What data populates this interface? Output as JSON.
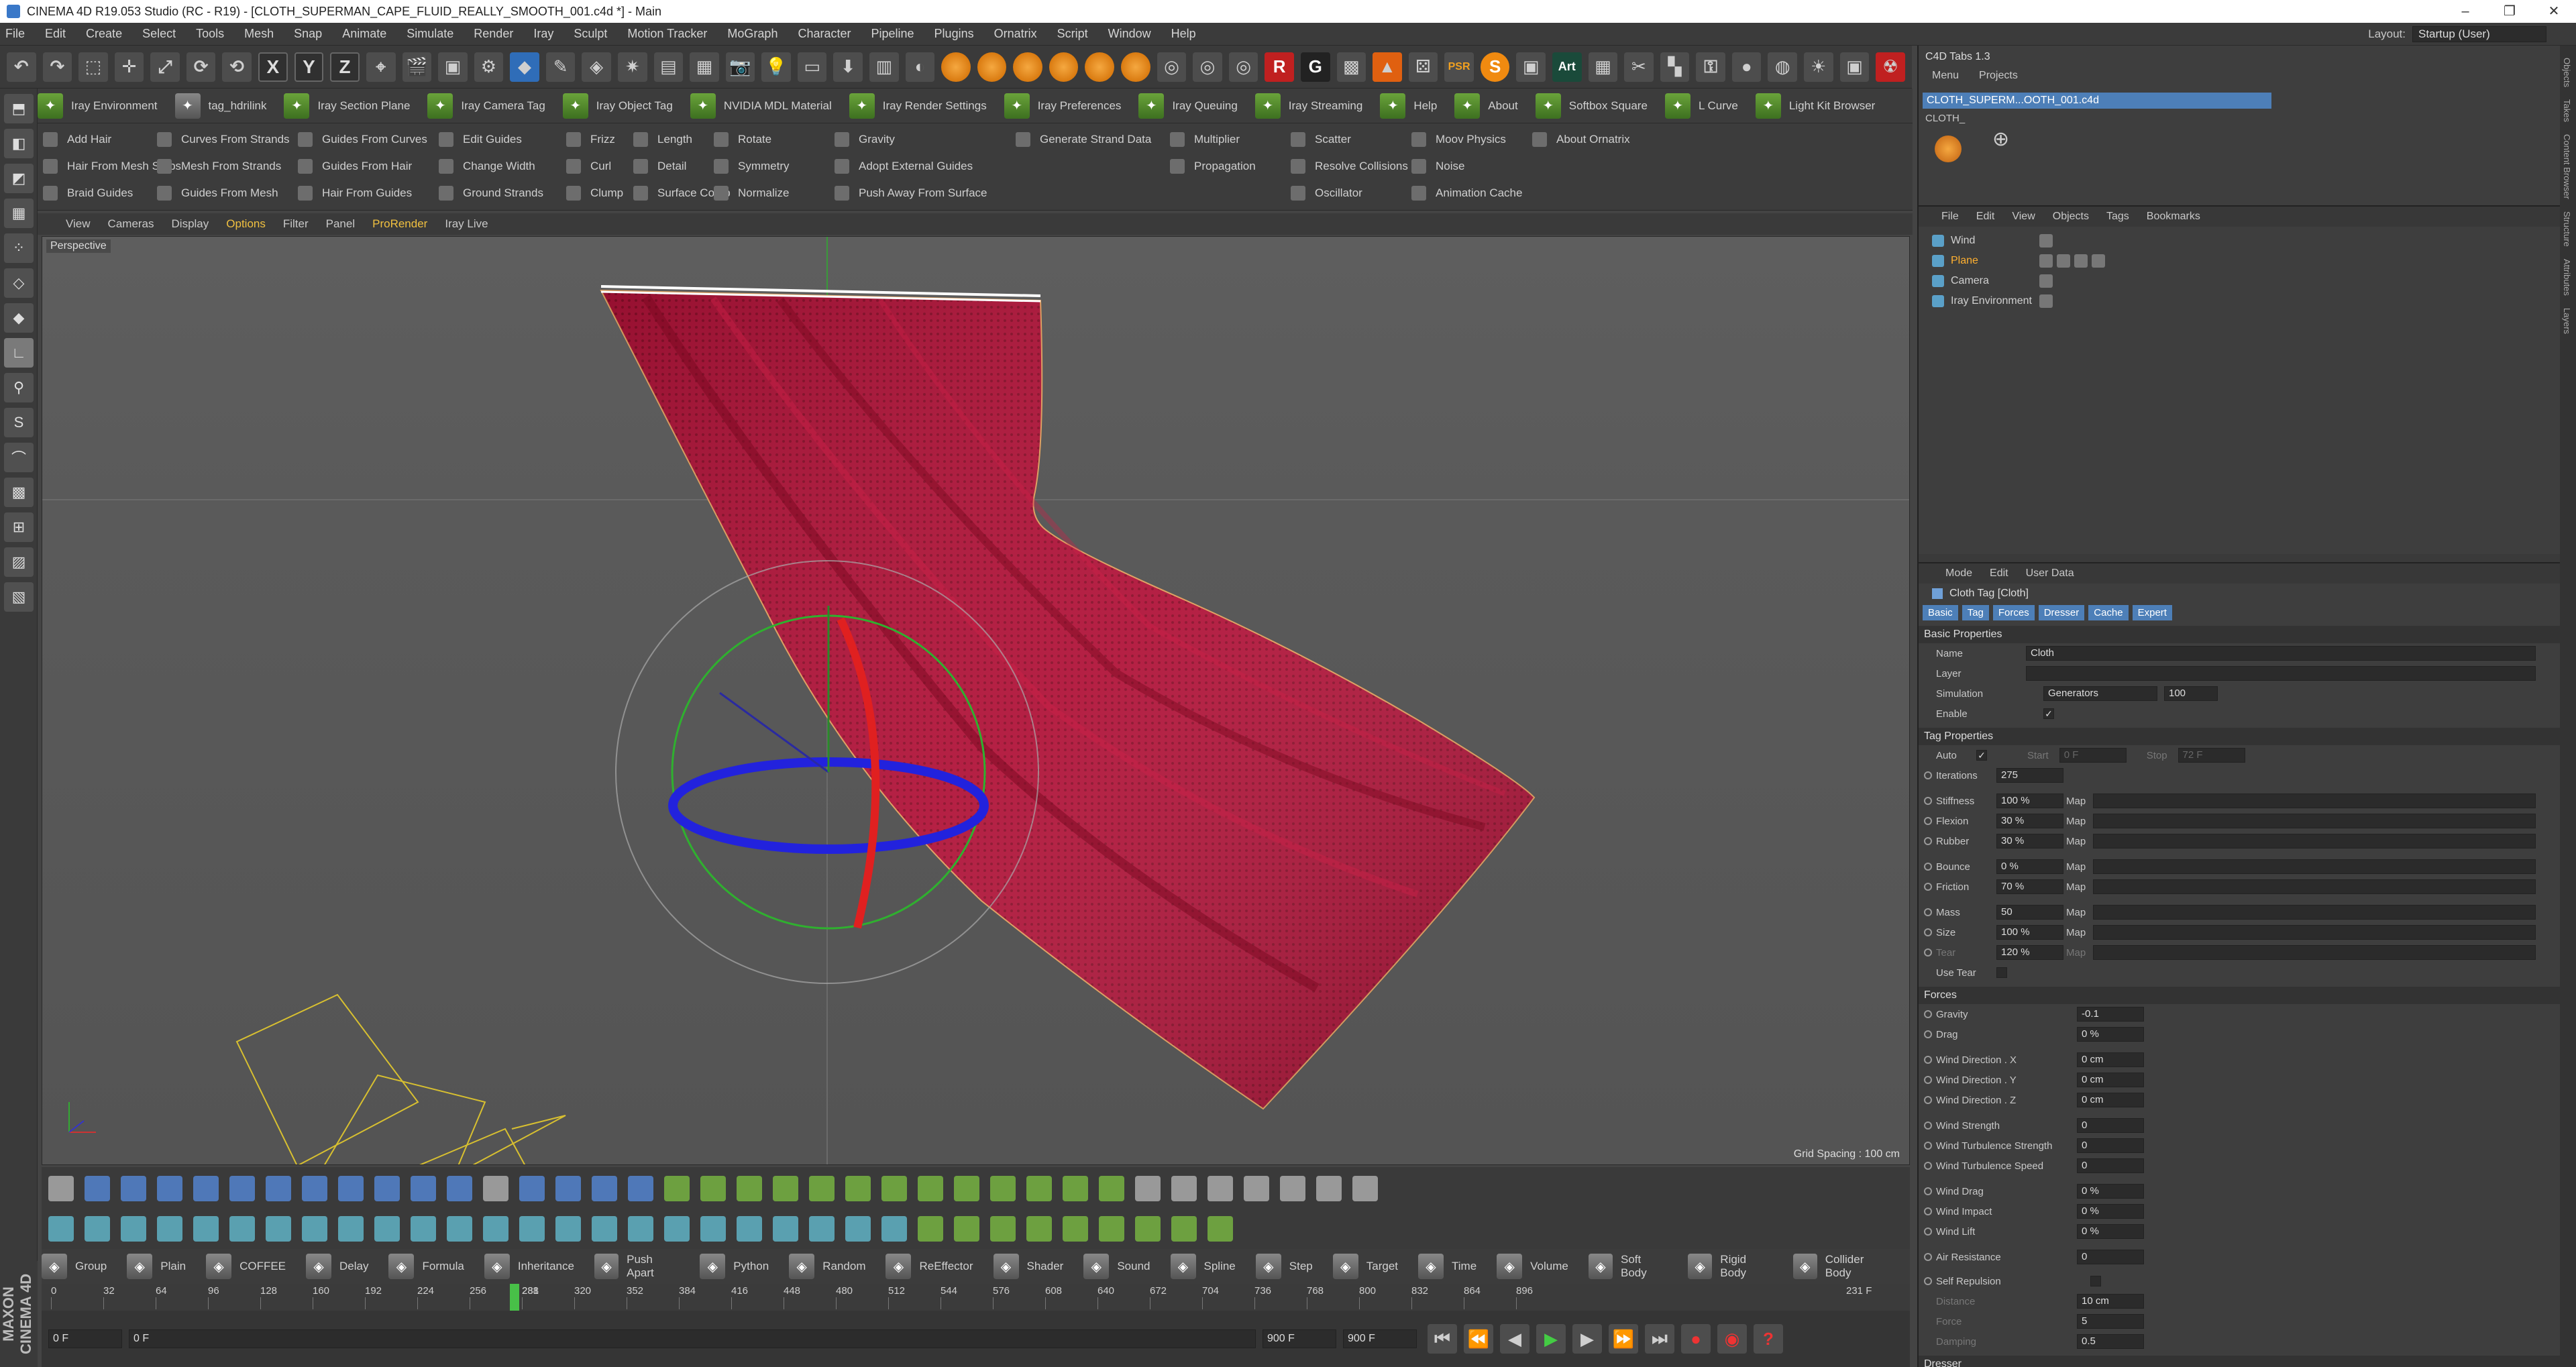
{
  "window": {
    "title": "CINEMA 4D R19.053 Studio (RC - R19) - [CLOTH_SUPERMAN_CAPE_FLUID_REALLY_SMOOTH_001.c4d *] - Main"
  },
  "menubar": [
    "File",
    "Edit",
    "Create",
    "Select",
    "Tools",
    "Mesh",
    "Snap",
    "Animate",
    "Simulate",
    "Render",
    "Iray",
    "Sculpt",
    "Motion Tracker",
    "MoGraph",
    "Character",
    "Pipeline",
    "Plugins",
    "Ornatrix",
    "Script",
    "Window",
    "Help"
  ],
  "layout": {
    "label": "Layout:",
    "value": "Startup (User)"
  },
  "iray_tabs": [
    "Iray Environment",
    "tag_hdrilink",
    "Iray Section Plane",
    "Iray Camera Tag",
    "Iray Object Tag",
    "NVIDIA MDL Material",
    "Iray Render Settings",
    "Iray Preferences",
    "Iray Queuing",
    "Iray Streaming",
    "Help",
    "About",
    "Softbox Square",
    "L Curve",
    "Light Kit Browser"
  ],
  "hair_cols": [
    [
      "Add Hair",
      "Hair From Mesh Strips",
      "Braid Guides"
    ],
    [
      "Curves From Strands",
      "Mesh From Strands",
      "Guides From Mesh"
    ],
    [
      "Guides From Curves",
      "Guides From Hair",
      "Hair From Guides"
    ],
    [
      "Edit Guides",
      "Change Width",
      "Ground Strands"
    ],
    [
      "Frizz",
      "Curl",
      "Clump"
    ],
    [
      "Length",
      "Detail",
      "Surface Comb"
    ],
    [
      "Rotate",
      "Symmetry",
      "Normalize"
    ],
    [
      "Gravity",
      "Adopt External Guides",
      "Push Away From Surface"
    ],
    [
      "Generate Strand Data"
    ],
    [
      "Multiplier",
      "Propagation"
    ],
    [
      "Scatter",
      "Resolve Collisions",
      "Oscillator"
    ],
    [
      "Moov Physics",
      "Noise",
      "Animation Cache"
    ],
    [
      "About Ornatrix"
    ]
  ],
  "viewport_menu": [
    "View",
    "Cameras",
    "Display",
    "Options",
    "Filter",
    "Panel",
    "ProRender",
    "Iray Live"
  ],
  "viewport": {
    "label": "Perspective",
    "grid": "Grid Spacing : 100 cm"
  },
  "dynamics": [
    "Group",
    "Plain",
    "COFFEE",
    "Delay",
    "Formula",
    "Inheritance",
    "Push Apart",
    "Python",
    "Random",
    "ReEffector",
    "Shader",
    "Sound",
    "Spline",
    "Step",
    "Target",
    "Time",
    "Volume",
    "Soft Body",
    "Rigid Body",
    "Collider Body"
  ],
  "timeline": {
    "ticks": [
      "0",
      "32",
      "64",
      "96",
      "128",
      "160",
      "192",
      "224",
      "256",
      "288",
      "320",
      "352",
      "384",
      "416",
      "448",
      "480",
      "512",
      "544",
      "576",
      "608",
      "640",
      "672",
      "704",
      "736",
      "768",
      "800",
      "832",
      "864",
      "896"
    ],
    "current": "231",
    "end_label": "231 F"
  },
  "controls": {
    "start": "0 F",
    "range_start": "0 F",
    "range_end": "900 F",
    "end": "900 F"
  },
  "right": {
    "tabs_header": "C4D Tabs 1.3",
    "sub": [
      "Menu",
      "Projects"
    ],
    "doc_tab": "CLOTH_SUPERM...OOTH_001.c4d",
    "doc_label": "CLOTH_",
    "objmenu": [
      "File",
      "Edit",
      "View",
      "Objects",
      "Tags",
      "Bookmarks"
    ],
    "objects": [
      "Wind",
      "Plane",
      "Camera",
      "Iray Environment"
    ],
    "attrmenu": [
      "Mode",
      "Edit",
      "User Data"
    ],
    "attr_title": "Cloth Tag [Cloth]",
    "attr_tabs": [
      "Basic",
      "Tag",
      "Forces",
      "Dresser",
      "Cache",
      "Expert"
    ],
    "basic_header": "Basic Properties",
    "name_label": "Name",
    "name_value": "Cloth",
    "layer_label": "Layer",
    "sim_label": "Simulation",
    "sim_value": "Generators",
    "sim_amount": "100",
    "enable_label": "Enable",
    "tag_header": "Tag Properties",
    "auto_label": "Auto",
    "start_label": "Start",
    "start_value": "0 F",
    "stop_label": "Stop",
    "stop_value": "72 F",
    "props": [
      {
        "label": "Iterations",
        "value": "275",
        "map": false
      },
      {
        "label": "Stiffness",
        "value": "100 %",
        "map": true
      },
      {
        "label": "Flexion",
        "value": "30 %",
        "map": true
      },
      {
        "label": "Rubber",
        "value": "30 %",
        "map": true
      },
      {
        "label": "Bounce",
        "value": "0 %",
        "map": true
      },
      {
        "label": "Friction",
        "value": "70 %",
        "map": true
      },
      {
        "label": "Mass",
        "value": "50",
        "map": true
      },
      {
        "label": "Size",
        "value": "100 %",
        "map": true
      },
      {
        "label": "Tear",
        "value": "120 %",
        "map": true
      }
    ],
    "map_label": "Map",
    "use_tear": "Use Tear",
    "forces_header": "Forces",
    "forces": [
      {
        "label": "Gravity",
        "value": "-0.1"
      },
      {
        "label": "Drag",
        "value": "0 %"
      },
      {
        "label": "Wind Direction . X",
        "value": "0 cm"
      },
      {
        "label": "Wind Direction . Y",
        "value": "0 cm"
      },
      {
        "label": "Wind Direction . Z",
        "value": "0 cm"
      },
      {
        "label": "Wind Strength",
        "value": "0"
      },
      {
        "label": "Wind Turbulence Strength",
        "value": "0"
      },
      {
        "label": "Wind Turbulence Speed",
        "value": "0"
      },
      {
        "label": "Wind Drag",
        "value": "0 %"
      },
      {
        "label": "Wind Impact",
        "value": "0 %"
      },
      {
        "label": "Wind Lift",
        "value": "0 %"
      },
      {
        "label": "Air Resistance",
        "value": "0"
      }
    ],
    "self_rep": "Self Repulsion",
    "self_props": [
      {
        "label": "Distance",
        "value": "10 cm"
      },
      {
        "label": "Force",
        "value": "5"
      },
      {
        "label": "Damping",
        "value": "0.5"
      }
    ],
    "dresser": "Dresser",
    "side_tabs": [
      "Objects",
      "Takes",
      "Content Browser",
      "Structure",
      "Attributes",
      "Layers"
    ]
  }
}
